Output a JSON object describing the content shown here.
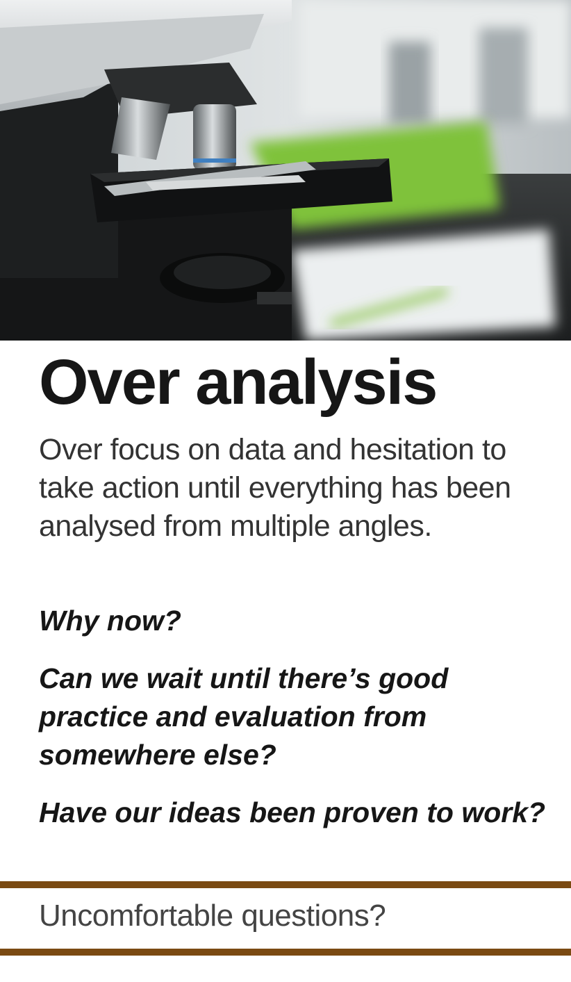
{
  "hero": {
    "image_subject": "microscope"
  },
  "title": "Over analysis",
  "description": "Over focus on data and hesitation to take action until everything has been analysed from multiple angles.",
  "questions": [
    "Why now?",
    "Can we wait until there’s good practice and evaluation from somewhere else?",
    "Have our ideas been proven to work?"
  ],
  "footer": {
    "label": "Uncomfortable questions?"
  },
  "colors": {
    "accent_rule": "#7a4a12",
    "title_text": "#161616",
    "body_text": "#333333",
    "lab_green": "#7fc23a"
  }
}
